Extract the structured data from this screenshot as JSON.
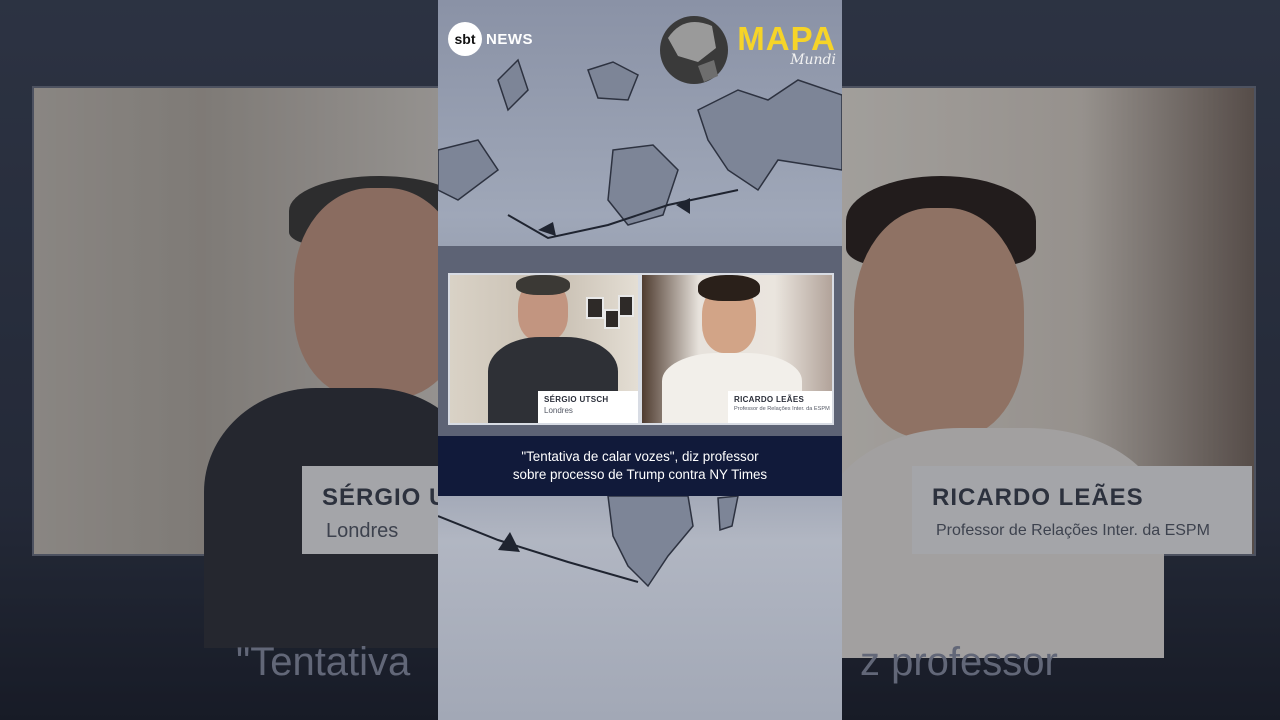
{
  "brand": {
    "network_logo": "sbt",
    "network_label": "NEWS",
    "show_title": "MAPA",
    "show_subtitle": "Mundi"
  },
  "participants": [
    {
      "name": "SÉRGIO UTSCH",
      "subtitle": "Londres"
    },
    {
      "name": "RICARDO LEÃES",
      "subtitle": "Professor de Relações Inter. da ESPM"
    }
  ],
  "caption": {
    "line1": "\"Tentativa de calar vozes\", diz professor",
    "line2": "sobre processo de Trump contra NY Times"
  },
  "background": {
    "left_name": "SÉRGIO UT",
    "left_sub": "Londres",
    "right_name": "RICARDO LEÃES",
    "right_sub": "Professor de Relações Inter. da ESPM",
    "left_caption": "\"Tentativa",
    "right_caption": "z professor"
  },
  "colors": {
    "accent_yellow": "#f6d428",
    "caption_bar": "#111a3a"
  }
}
